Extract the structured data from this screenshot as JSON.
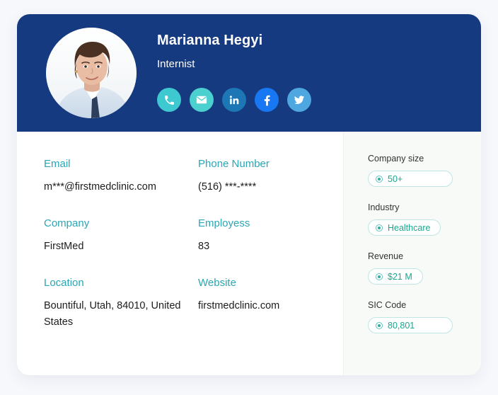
{
  "profile": {
    "name": "Marianna Hegyi",
    "title": "Internist",
    "avatar_icon": "person-photo"
  },
  "social": [
    {
      "name": "phone",
      "icon": "phone-icon",
      "color": "#3ec8d0"
    },
    {
      "name": "email",
      "icon": "envelope-icon",
      "color": "#4ccfcf"
    },
    {
      "name": "linkedin",
      "icon": "linkedin-icon",
      "color": "#1d77b5"
    },
    {
      "name": "facebook",
      "icon": "facebook-icon",
      "color": "#1877f2"
    },
    {
      "name": "twitter",
      "icon": "twitter-icon",
      "color": "#4ea7e0"
    }
  ],
  "fields": [
    {
      "label": "Email",
      "value": "m***@firstmedclinic.com"
    },
    {
      "label": "Phone Number",
      "value": "(516) ***-****"
    },
    {
      "label": "Company",
      "value": "FirstMed"
    },
    {
      "label": "Employess",
      "value": "83"
    },
    {
      "label": "Location",
      "value": "Bountiful, Utah, 84010, United States"
    },
    {
      "label": "Website",
      "value": "firstmedclinic.com"
    }
  ],
  "sidebar": [
    {
      "label": "Company size",
      "value": "50+",
      "icon": "radio-selected-icon"
    },
    {
      "label": "Industry",
      "value": "Healthcare",
      "icon": "radio-selected-icon"
    },
    {
      "label": "Revenue",
      "value": "$21 M",
      "icon": "radio-selected-icon"
    },
    {
      "label": "SIC Code",
      "value": "80,801",
      "icon": "radio-selected-icon"
    }
  ],
  "colors": {
    "header_bg": "#153a7f",
    "label_teal": "#2aa6b4",
    "pill_text": "#19a78f",
    "pill_border": "#bfe6e4",
    "page_bg": "#f7f8fc",
    "sidebar_bg": "#f7faf7"
  }
}
